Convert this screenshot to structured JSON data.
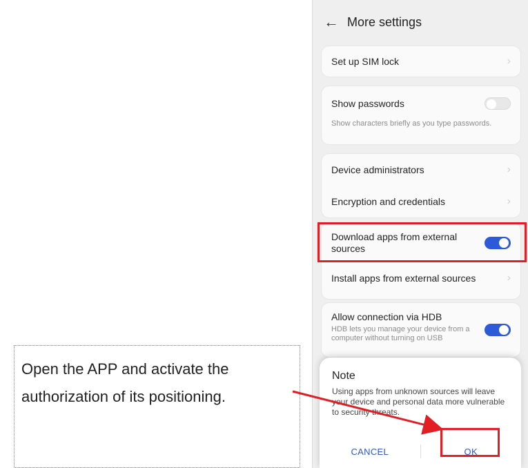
{
  "header": {
    "title": "More settings"
  },
  "settings": {
    "set_up_sim_lock": "Set up SIM lock",
    "show_passwords": "Show passwords",
    "show_passwords_help": "Show characters briefly as you type passwords.",
    "device_administrators": "Device administrators",
    "encryption_credentials": "Encryption and credentials",
    "download_external": "Download apps from external sources",
    "install_external": "Install apps from external sources",
    "allow_hdb": "Allow connection via HDB",
    "allow_hdb_help": "HDB lets you manage your device from a computer without turning on USB"
  },
  "dialog": {
    "title": "Note",
    "body": "Using apps from unknown sources will leave your device and personal data more vulnerable to security threats.",
    "cancel": "CANCEL",
    "ok": "OK"
  },
  "annotation": {
    "text": "Open the APP and activate the authorization of its positioning."
  },
  "colors": {
    "highlight": "#e21d23",
    "accent": "#2d5ad8",
    "dialog_button": "#2f57c8"
  },
  "icons": {
    "back": "arrow-left-icon",
    "chevron": "chevron-right-icon"
  }
}
